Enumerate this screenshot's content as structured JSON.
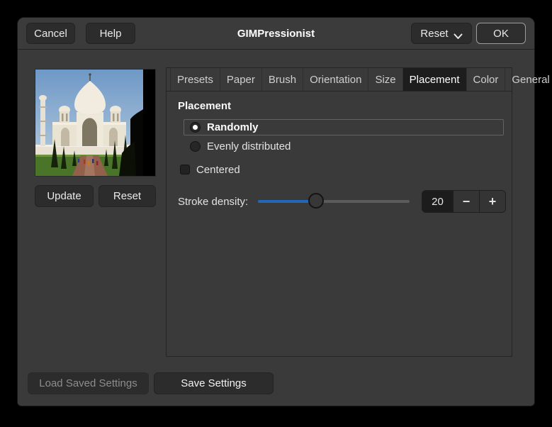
{
  "window": {
    "title": "GIMPressionist"
  },
  "header": {
    "cancel_label": "Cancel",
    "help_label": "Help",
    "reset_label": "Reset",
    "ok_label": "OK"
  },
  "preview": {
    "update_label": "Update",
    "reset_label": "Reset",
    "image_description": "Taj Mahal photo thumbnail"
  },
  "tabs": {
    "active": "Placement",
    "items": [
      {
        "label": "Presets"
      },
      {
        "label": "Paper"
      },
      {
        "label": "Brush"
      },
      {
        "label": "Orientation"
      },
      {
        "label": "Size"
      },
      {
        "label": "Placement"
      },
      {
        "label": "Color"
      },
      {
        "label": "General"
      }
    ]
  },
  "placement": {
    "heading": "Placement",
    "options": [
      {
        "label": "Randomly",
        "selected": true
      },
      {
        "label": "Evenly distributed",
        "selected": false
      }
    ],
    "centered": {
      "label": "Centered",
      "checked": false
    },
    "stroke_density": {
      "label": "Stroke density:",
      "value": "20",
      "slider_fraction": 0.385,
      "minus_glyph": "−",
      "plus_glyph": "+"
    }
  },
  "footer": {
    "load_label": "Load Saved Settings",
    "load_enabled": false,
    "save_label": "Save Settings"
  },
  "colors": {
    "accent_blue": "#2368b4",
    "window_bg": "#3a3a3a",
    "active_tab_bg": "#1d1d1d",
    "button_bg": "#2c2c2c"
  }
}
